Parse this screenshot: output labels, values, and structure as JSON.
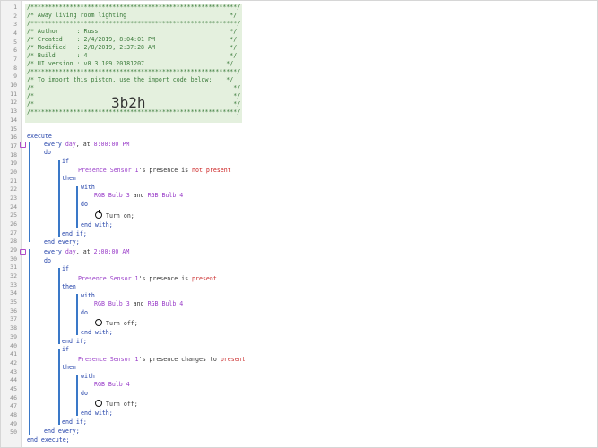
{
  "line_numbers": [
    "1",
    "2",
    "3",
    "4",
    "5",
    "6",
    "7",
    "8",
    "9",
    "10",
    "11",
    "12",
    "13",
    "14",
    "15",
    "16",
    "17",
    "18",
    "19",
    "20",
    "21",
    "22",
    "23",
    "24",
    "25",
    "26",
    "27",
    "28",
    "29",
    "30",
    "31",
    "32",
    "33",
    "34",
    "35",
    "36",
    "37",
    "38",
    "39",
    "40",
    "41",
    "42",
    "43",
    "44",
    "45",
    "46",
    "47",
    "48",
    "49",
    "50"
  ],
  "header": {
    "border": "/**********************************************************/",
    "title": "/* Away living room lighting                             */",
    "author": "/* Author     : Russ                                     */",
    "created": "/* Created    : 2/4/2019, 8:04:01 PM                     */",
    "modified": "/* Modified   : 2/8/2019, 2:37:28 AM                     */",
    "build": "/* Build      : 4                                        */",
    "ui_version": "/* UI version : v0.3.109.20181207                       */",
    "import_note": "/* To import this piston, use the import code below:    */",
    "blank": "/*                                                        */",
    "import_code": "3b2h"
  },
  "code": {
    "execute": "execute",
    "end_execute": "end execute;",
    "every1_prefix": "every ",
    "every1_unit": "day",
    "every1_at": ", at ",
    "every1_time": "8:00:00 PM",
    "every2_prefix": "every ",
    "every2_unit": "day",
    "every2_at": ", at ",
    "every2_time": "2:00:00 AM",
    "do": "do",
    "if": "if",
    "then": "then",
    "with": "with",
    "end_if": "end if;",
    "end_with": "end with;",
    "end_every": "end every;",
    "sensor_a": "Presence Sensor 1",
    "sensor_suffix": "'s presence is ",
    "not_present": "not present",
    "present": "present",
    "sensor_changes_suffix": "'s presence changes to ",
    "bulb3": "RGB Bulb 3",
    "and": " and ",
    "bulb4": "RGB Bulb 4",
    "turn_on": "Turn on;",
    "turn_off": "Turn off;"
  },
  "colors": {
    "comment": "#3a7a3a",
    "keyword": "#1f3fa8",
    "device": "#9a3fc9",
    "negative_value": "#cc2222",
    "block_line": "#3a78c8"
  }
}
